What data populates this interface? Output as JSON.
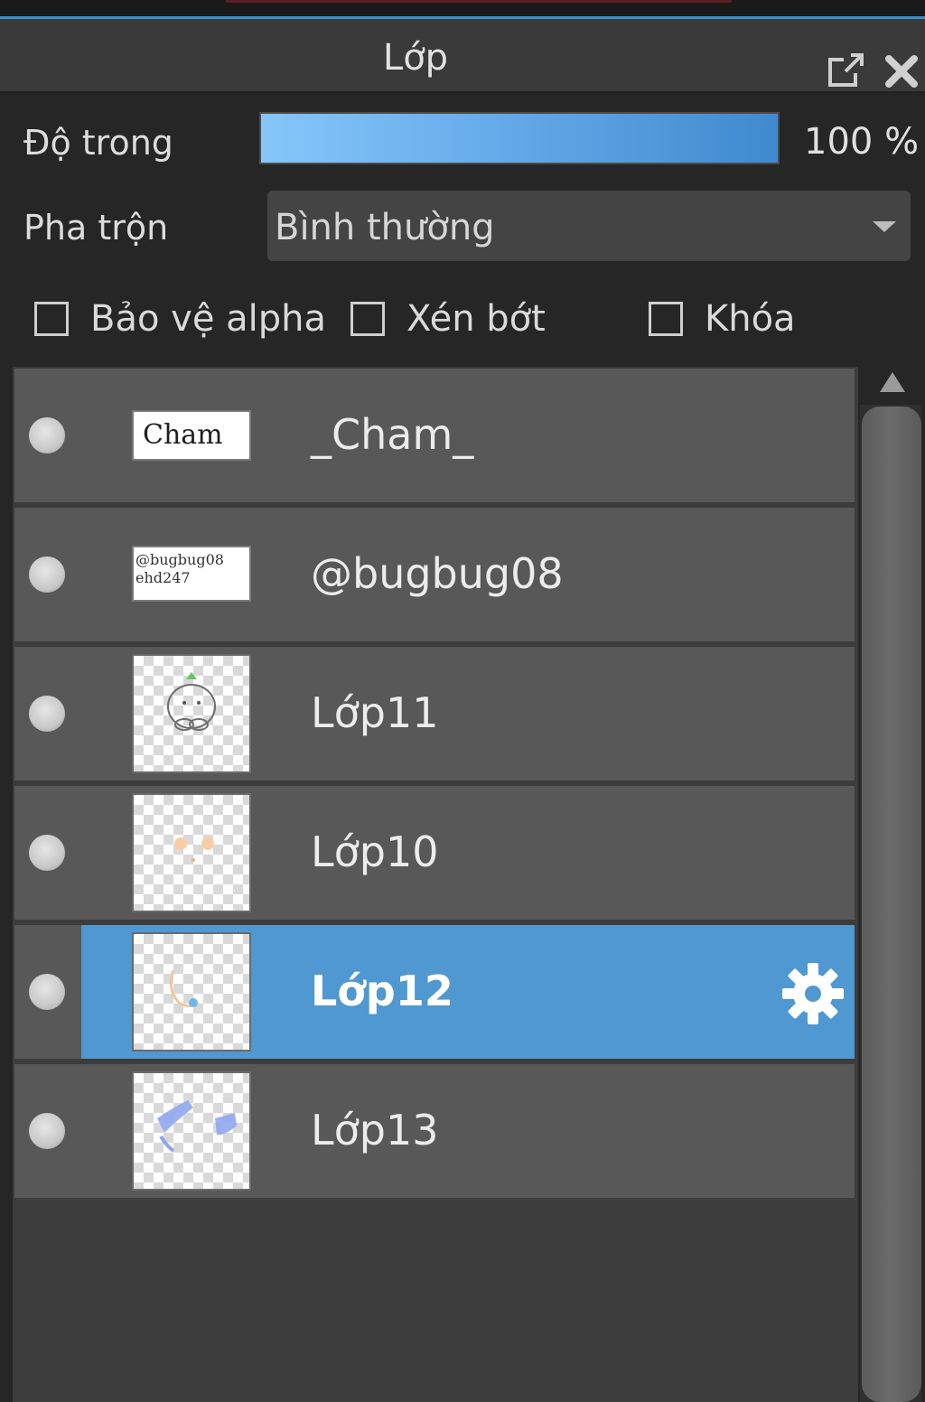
{
  "panel": {
    "title": "Lớp",
    "popout_icon": "popout-icon",
    "close_icon": "close-icon"
  },
  "opacity": {
    "label": "Độ trong",
    "value_text": "100 %",
    "level": 1.0
  },
  "blend": {
    "label": "Pha trộn",
    "selected": "Bình thường"
  },
  "checks": [
    {
      "label": "Bảo vệ alpha",
      "checked": false
    },
    {
      "label": "Xén bớt",
      "checked": false
    },
    {
      "label": "Khóa",
      "checked": false
    }
  ],
  "layers": [
    {
      "name": "_Cham_",
      "thumb_text": "Cham",
      "selected": false
    },
    {
      "name": "@bugbug08",
      "thumb_text": "@bugbug08 ehd247",
      "selected": false
    },
    {
      "name": "Lớp11",
      "thumb_text": "",
      "selected": false
    },
    {
      "name": "Lớp10",
      "thumb_text": "",
      "selected": false
    },
    {
      "name": "Lớp12",
      "thumb_text": "",
      "selected": true
    },
    {
      "name": "Lớp13",
      "thumb_text": "",
      "selected": false
    }
  ],
  "colors": {
    "accent": "#4f98d1",
    "opacity_bar": "#62a8e8",
    "layer_bg": "#585858",
    "panel_bg": "#262626"
  }
}
